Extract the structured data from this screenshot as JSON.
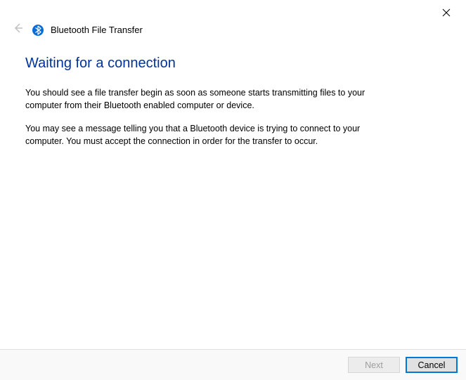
{
  "header": {
    "app_title": "Bluetooth File Transfer"
  },
  "content": {
    "heading": "Waiting for a connection",
    "paragraph1": "You should see a file transfer begin as soon as someone starts transmitting files to your computer from their Bluetooth enabled computer or device.",
    "paragraph2": "You may see a message telling you that a Bluetooth device is trying to connect to your computer. You must accept the connection in order for the transfer to occur."
  },
  "footer": {
    "next_label": "Next",
    "cancel_label": "Cancel"
  },
  "colors": {
    "heading_color": "#003399",
    "accent_border": "#0078d7"
  }
}
